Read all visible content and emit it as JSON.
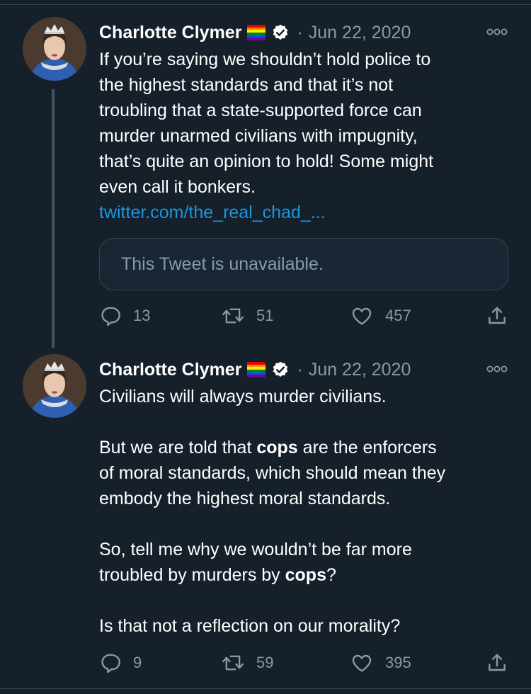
{
  "tweets": [
    {
      "author": "Charlotte Clymer",
      "separator": "·",
      "date": "Jun 22, 2020",
      "lines": [
        "If you’re saying we shouldn’t hold police to",
        "the highest standards and that it’s not",
        "troubling that a state-supported force can",
        "murder unarmed civilians with impugnity,",
        "that’s quite an opinion to hold! Some might",
        "even call it bonkers."
      ],
      "link": "twitter.com/the_real_chad_...",
      "quote_text": "This Tweet is unavailable.",
      "replies": "13",
      "retweets": "51",
      "likes": "457"
    },
    {
      "author": "Charlotte Clymer",
      "separator": "·",
      "date": "Jun 22, 2020",
      "para1": "Civilians will always murder civilians.",
      "para2": {
        "line1_a": "But we are told that ",
        "line1_bold": "cops",
        "line1_b": " are the enforcers",
        "line2": "of moral standards, which should mean they",
        "line3": "embody the highest moral standards."
      },
      "para3": {
        "line1": "So, tell me why we wouldn’t be far more",
        "line2_a": "troubled by murders by ",
        "line2_bold": "cops",
        "line2_b": "?"
      },
      "para4": "Is that not a reflection on our morality?",
      "replies": "9",
      "retweets": "59",
      "likes": "395"
    }
  ],
  "icons": [
    "avatar",
    "rainbow-flag-emoji",
    "verified-badge-icon",
    "more-options-icon",
    "reply-icon",
    "retweet-icon",
    "like-icon",
    "share-icon"
  ],
  "colors": {
    "background": "#15202b",
    "secondary_text": "#8899a6",
    "link": "#1b95e0",
    "border": "#38444d",
    "thread_line": "#3d5466"
  }
}
